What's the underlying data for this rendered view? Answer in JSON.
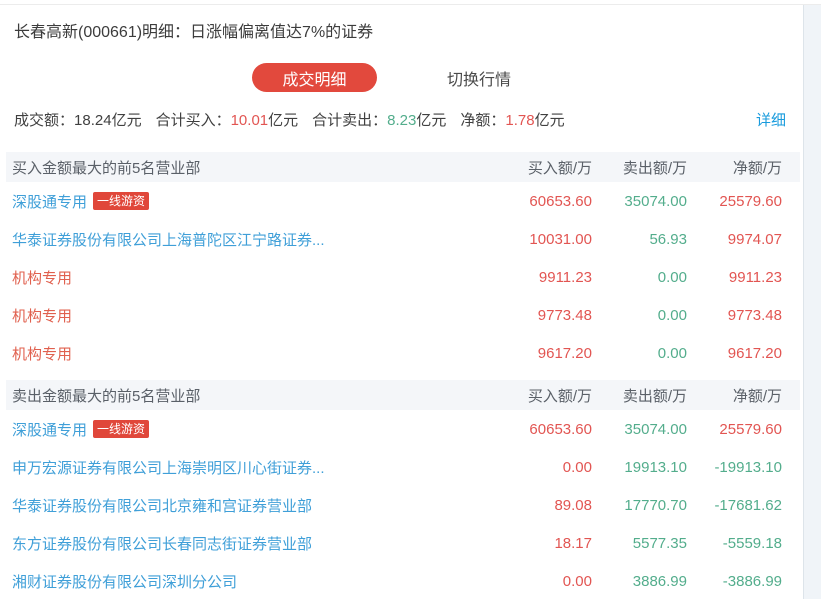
{
  "header": {
    "title": "长春高新(000661)明细：日涨幅偏离值达7%的证券",
    "tab_active": "成交明细",
    "tab_inactive": "切换行情"
  },
  "summary": {
    "items": [
      {
        "label": "成交额：",
        "value": "18.24",
        "unit": "亿元",
        "value_color": "dark"
      },
      {
        "label": "合计买入：",
        "value": "10.01",
        "unit": "亿元",
        "value_color": "red"
      },
      {
        "label": "合计卖出：",
        "value": "8.23",
        "unit": "亿元",
        "value_color": "green"
      },
      {
        "label": "净额：",
        "value": "1.78",
        "unit": "亿元",
        "value_color": "red"
      }
    ],
    "detail_link": "详细"
  },
  "tables": [
    {
      "title": "买入金额最大的前5名营业部",
      "columns": [
        "买入额/万",
        "卖出额/万",
        "净额/万"
      ],
      "rows": [
        {
          "name": "深股通专用",
          "badge": "一线游资",
          "name_style": "link",
          "buy": "60653.60",
          "sell": "35074.00",
          "net": "25579.60",
          "net_sign": "positive"
        },
        {
          "name": "华泰证券股份有限公司上海普陀区江宁路证券...",
          "name_style": "link",
          "buy": "10031.00",
          "sell": "56.93",
          "net": "9974.07",
          "net_sign": "positive"
        },
        {
          "name": "机构专用",
          "name_style": "red",
          "buy": "9911.23",
          "sell": "0.00",
          "net": "9911.23",
          "net_sign": "positive"
        },
        {
          "name": "机构专用",
          "name_style": "red",
          "buy": "9773.48",
          "sell": "0.00",
          "net": "9773.48",
          "net_sign": "positive"
        },
        {
          "name": "机构专用",
          "name_style": "red",
          "buy": "9617.20",
          "sell": "0.00",
          "net": "9617.20",
          "net_sign": "positive"
        }
      ]
    },
    {
      "title": "卖出金额最大的前5名营业部",
      "columns": [
        "买入额/万",
        "卖出额/万",
        "净额/万"
      ],
      "rows": [
        {
          "name": "深股通专用",
          "badge": "一线游资",
          "name_style": "link",
          "buy": "60653.60",
          "sell": "35074.00",
          "net": "25579.60",
          "net_sign": "positive"
        },
        {
          "name": "申万宏源证券有限公司上海崇明区川心街证券...",
          "name_style": "link",
          "buy": "0.00",
          "sell": "19913.10",
          "net": "-19913.10",
          "net_sign": "negative"
        },
        {
          "name": "华泰证券股份有限公司北京雍和宫证券营业部",
          "name_style": "link",
          "buy": "89.08",
          "sell": "17770.70",
          "net": "-17681.62",
          "net_sign": "negative"
        },
        {
          "name": "东方证券股份有限公司长春同志街证券营业部",
          "name_style": "link",
          "buy": "18.17",
          "sell": "5577.35",
          "net": "-5559.18",
          "net_sign": "negative"
        },
        {
          "name": "湘财证券股份有限公司深圳分公司",
          "name_style": "link",
          "buy": "0.00",
          "sell": "3886.99",
          "net": "-3886.99",
          "net_sign": "negative"
        }
      ]
    }
  ],
  "colors": {
    "accent_red": "#e2493d",
    "badge_red": "#e0473a",
    "num_red": "#e25552",
    "num_green": "#53ad8c",
    "broker_link_blue": "#3f9fd8",
    "detail_link_blue": "#189bdd",
    "table_header_bg": "#f4f6f9"
  }
}
